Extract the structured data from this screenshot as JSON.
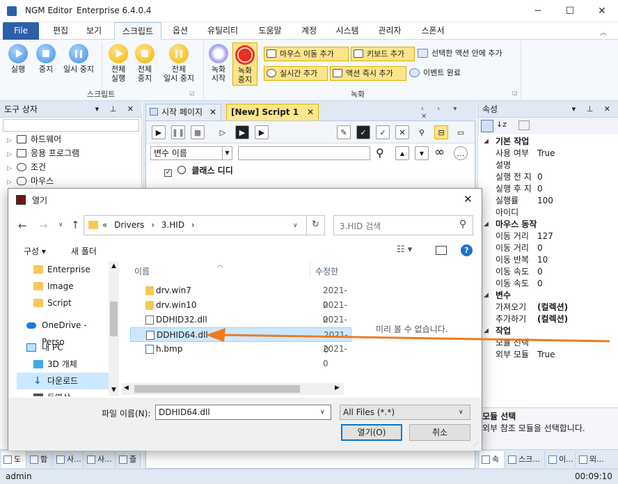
{
  "app": {
    "title": "NGM Editor",
    "version": "Enterprise 6.4.0.4"
  },
  "window": {
    "minimize": "─",
    "maximize": "☐",
    "close": "✕"
  },
  "menu": [
    "File",
    "편집",
    "보기",
    "스크립트",
    "옵션",
    "유틸리티",
    "도움말",
    "계정",
    "시스템",
    "관리자",
    "스폰서"
  ],
  "ribbon": {
    "run": "실행",
    "stop": "중지",
    "pause": "일시 중지",
    "run_all": [
      "전체",
      "실행"
    ],
    "stop_all": [
      "전체",
      "중지"
    ],
    "pause_all": [
      "전체",
      "일시 중지"
    ],
    "group_script": "스크립트",
    "rec_start": [
      "녹화",
      "시작"
    ],
    "rec_stop": [
      "녹화",
      "중지"
    ],
    "add_mouse_move": "마우스 이동 추가",
    "add_keyboard": "키보드 추가",
    "add_in_selected": "선택한 액션 안에 추가",
    "add_realtime": "실시간 추가",
    "add_action_now": "액션 즉시 추가",
    "event_done": "이벤트 완료",
    "group_record": "녹화"
  },
  "toolbox": {
    "title": "도구 상자",
    "items": [
      "하드웨어",
      "응용 프로그램",
      "조건",
      "마우스"
    ]
  },
  "left_tabs": [
    "도",
    "함",
    "사...",
    "사...",
    "즐"
  ],
  "doc": {
    "tabs": [
      "시작 페이지",
      "[New] Script 1"
    ],
    "var_label": "변수 이름",
    "action": "클래스 디디"
  },
  "properties": {
    "title": "속성",
    "rows": [
      {
        "type": "cat",
        "k": "기본 작업"
      },
      {
        "k": "사용 여부",
        "v": "True"
      },
      {
        "k": "설명",
        "v": ""
      },
      {
        "k": "실행 전 지",
        "v": "0"
      },
      {
        "k": "실행 후 지",
        "v": "0"
      },
      {
        "k": "실행률",
        "v": "100"
      },
      {
        "k": "아이디",
        "v": ""
      },
      {
        "type": "cat",
        "k": "마우스 동작"
      },
      {
        "k": "이동 거리",
        "v": "127"
      },
      {
        "k": "이동 거리",
        "v": "0"
      },
      {
        "k": "이동 반복",
        "v": "10"
      },
      {
        "k": "이동 속도",
        "v": "0"
      },
      {
        "k": "이동 속도",
        "v": "0"
      },
      {
        "type": "cat",
        "k": "변수"
      },
      {
        "k": "가져오기",
        "v": "(컬렉션)",
        "bold": true
      },
      {
        "k": "추가하기",
        "v": "(컬렉션)",
        "bold": true
      },
      {
        "type": "cat",
        "k": "작업"
      },
      {
        "k": "모듈 선택",
        "v": ""
      },
      {
        "k": "외부 모듈",
        "v": "True"
      }
    ],
    "desc_title": "모듈 선택",
    "desc": "외부 참조 모듈을 선택합니다.",
    "tabs": [
      "속",
      "스크...",
      "이...",
      "외..."
    ]
  },
  "status": {
    "user": "admin",
    "time": "00:09:10"
  },
  "dialog": {
    "title": "열기",
    "path": [
      "«",
      "Drivers",
      "›",
      "3.HID",
      "›"
    ],
    "search_placeholder": "3.HID 검색",
    "organize": "구성 ▾",
    "new_folder": "새 폴더",
    "nav": [
      {
        "label": "Enterprise",
        "kind": "folder"
      },
      {
        "label": "Image",
        "kind": "folder"
      },
      {
        "label": "Script",
        "kind": "folder"
      },
      {
        "label": "OneDrive - Perso",
        "kind": "cloud"
      },
      {
        "label": "내 PC",
        "kind": "pc"
      },
      {
        "label": "3D 개체",
        "kind": "3d"
      },
      {
        "label": "다운로드",
        "kind": "down"
      },
      {
        "label": "동영상",
        "kind": "video"
      }
    ],
    "col_name": "이름",
    "col_date": "수정한",
    "files": [
      {
        "name": "drv.win7",
        "date": "2021-0",
        "kind": "folder"
      },
      {
        "name": "drv.win10",
        "date": "2021-0",
        "kind": "folder"
      },
      {
        "name": "DDHID32.dll",
        "date": "2021-0",
        "kind": "dll"
      },
      {
        "name": "DDHID64.dll",
        "date": "2021-0",
        "kind": "dll",
        "selected": true
      },
      {
        "name": "h.bmp",
        "date": "2021-0",
        "kind": "bmp"
      }
    ],
    "preview": "미리 볼 수 없습니다.",
    "filename_label": "파일 이름(N):",
    "filename": "DDHID64.dll",
    "filter": "All Files (*.*)",
    "open": "열기(O)",
    "cancel": "취소"
  },
  "colors": {
    "accent": "#2b5faa",
    "highlight": "#ffe48a",
    "arrow": "#f07a1e",
    "selection": "#cce8ff"
  }
}
